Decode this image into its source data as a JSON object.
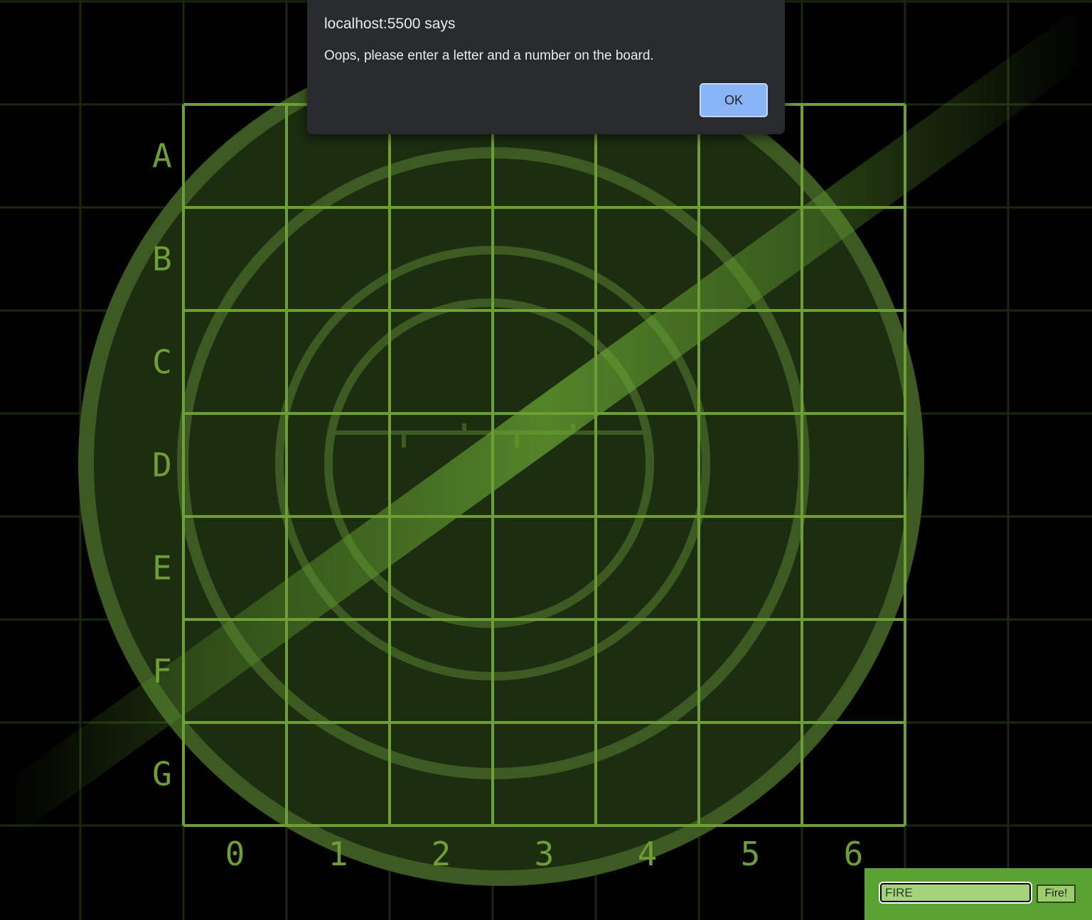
{
  "board": {
    "row_labels": [
      "A",
      "B",
      "C",
      "D",
      "E",
      "F",
      "G"
    ],
    "column_labels": [
      "0",
      "1",
      "2",
      "3",
      "4",
      "5",
      "6"
    ]
  },
  "fire_form": {
    "input_placeholder": "FIRE",
    "button_label": "Fire!"
  },
  "alert": {
    "title": "localhost:5500 says",
    "message": "Oops, please enter a letter and a number on the board.",
    "ok_label": "OK"
  },
  "colors": {
    "background": "#000000",
    "grid_line": "#6f9e37",
    "radar_fill": "#1c2d10",
    "radar_ring": "#3c5a22",
    "sweep": "#5f9a2e",
    "form_background": "#5aa232",
    "alert_background": "#292a2d",
    "alert_button": "#8ab4f8"
  }
}
